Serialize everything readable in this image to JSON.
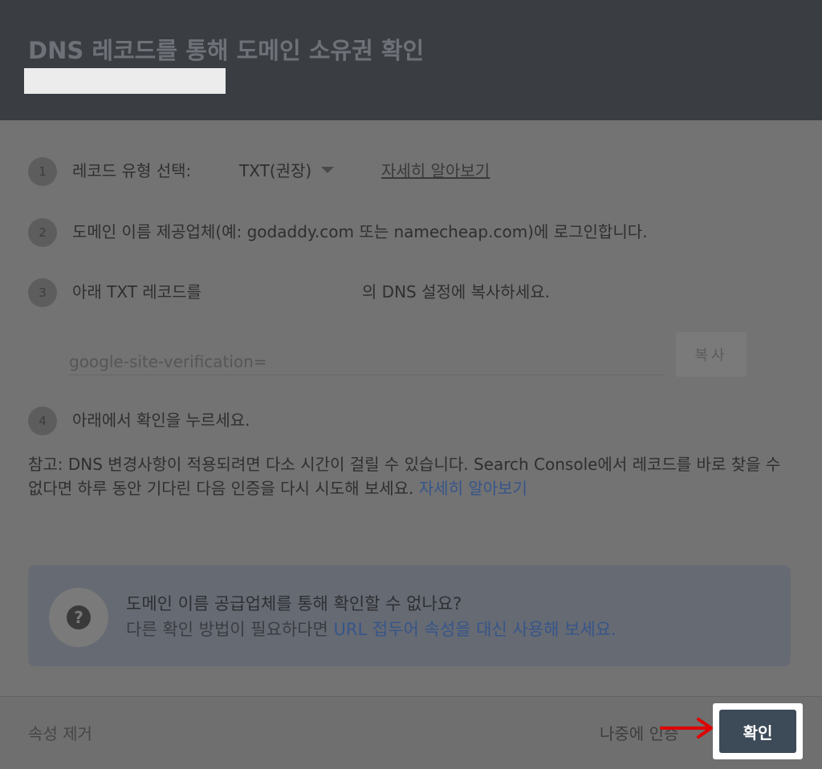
{
  "header": {
    "title": "DNS 레코드를 통해 도메인 소유권 확인"
  },
  "steps": [
    {
      "num": "1",
      "label": "레코드 유형 선택:",
      "record_type": "TXT(권장)",
      "learn_more": "자세히 알아보기"
    },
    {
      "num": "2",
      "text": "도메인 이름 제공업체(예: godaddy.com 또는 namecheap.com)에 로그인합니다."
    },
    {
      "num": "3",
      "text_before": "아래 TXT 레코드를",
      "text_after": "의 DNS 설정에 복사하세요."
    },
    {
      "num": "4",
      "text": "아래에서 확인을 누르세요."
    }
  ],
  "verification_field": {
    "value": "google-site-verification="
  },
  "copy_label": "복사",
  "note": {
    "text": "참고: DNS 변경사항이 적용되려면 다소 시간이 걸릴 수 있습니다. Search Console에서 레코드를 바로 찾을 수 없다면 하루 동안 기다린 다음 인증을 다시 시도해 보세요. ",
    "link": "자세히 알아보기"
  },
  "info_box": {
    "icon": "help-icon",
    "title": "도메인 이름 공급업체를 통해 확인할 수 없나요?",
    "body_prefix": "다른 확인 방법이 필요하다면 ",
    "body_link": "URL 접두어 속성을 대신 사용해 보세요."
  },
  "footer": {
    "remove_label": "속성 제거",
    "later_label": "나중에 인증",
    "confirm_label": "확인"
  },
  "colors": {
    "annotation_arrow": "#e00000",
    "confirm_button": "#3d4a57",
    "link_blue": "#36558a"
  }
}
